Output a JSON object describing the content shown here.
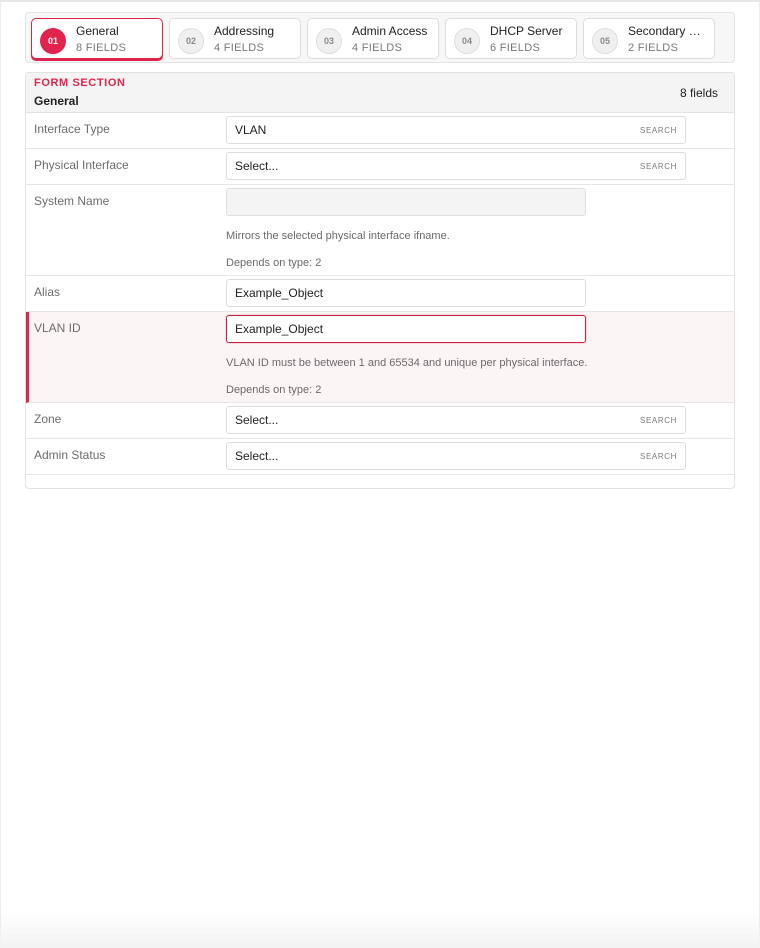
{
  "steps": [
    {
      "num": "01",
      "title": "General",
      "count": "8 FIELDS"
    },
    {
      "num": "02",
      "title": "Addressing",
      "count": "4 FIELDS"
    },
    {
      "num": "03",
      "title": "Admin Access",
      "count": "4 FIELDS"
    },
    {
      "num": "04",
      "title": "DHCP Server",
      "count": "6 FIELDS"
    },
    {
      "num": "05",
      "title": "Secondary …",
      "count": "2 FIELDS"
    }
  ],
  "section": {
    "kicker": "FORM SECTION",
    "title": "General",
    "field_count": "8 fields"
  },
  "search_label": "SEARCH",
  "fields": {
    "interface_type": {
      "label": "Interface Type",
      "value": "VLAN"
    },
    "physical_interface": {
      "label": "Physical Interface",
      "value": "Select..."
    },
    "system_name": {
      "label": "System Name",
      "value": "",
      "help": "Mirrors the selected physical interface ifname.",
      "depends": "Depends on type: 2"
    },
    "alias": {
      "label": "Alias",
      "value": "Example_Object"
    },
    "vlan_id": {
      "label": "VLAN ID",
      "value": "Example_Object",
      "help": "VLAN ID must be between 1 and 65534 and unique per physical interface.",
      "depends": "Depends on type: 2"
    },
    "zone": {
      "label": "Zone",
      "value": "Select..."
    },
    "admin_status": {
      "label": "Admin Status",
      "value": "Select..."
    }
  },
  "colors": {
    "accent": "#e0244e",
    "error_bg": "#fcf5f6"
  }
}
